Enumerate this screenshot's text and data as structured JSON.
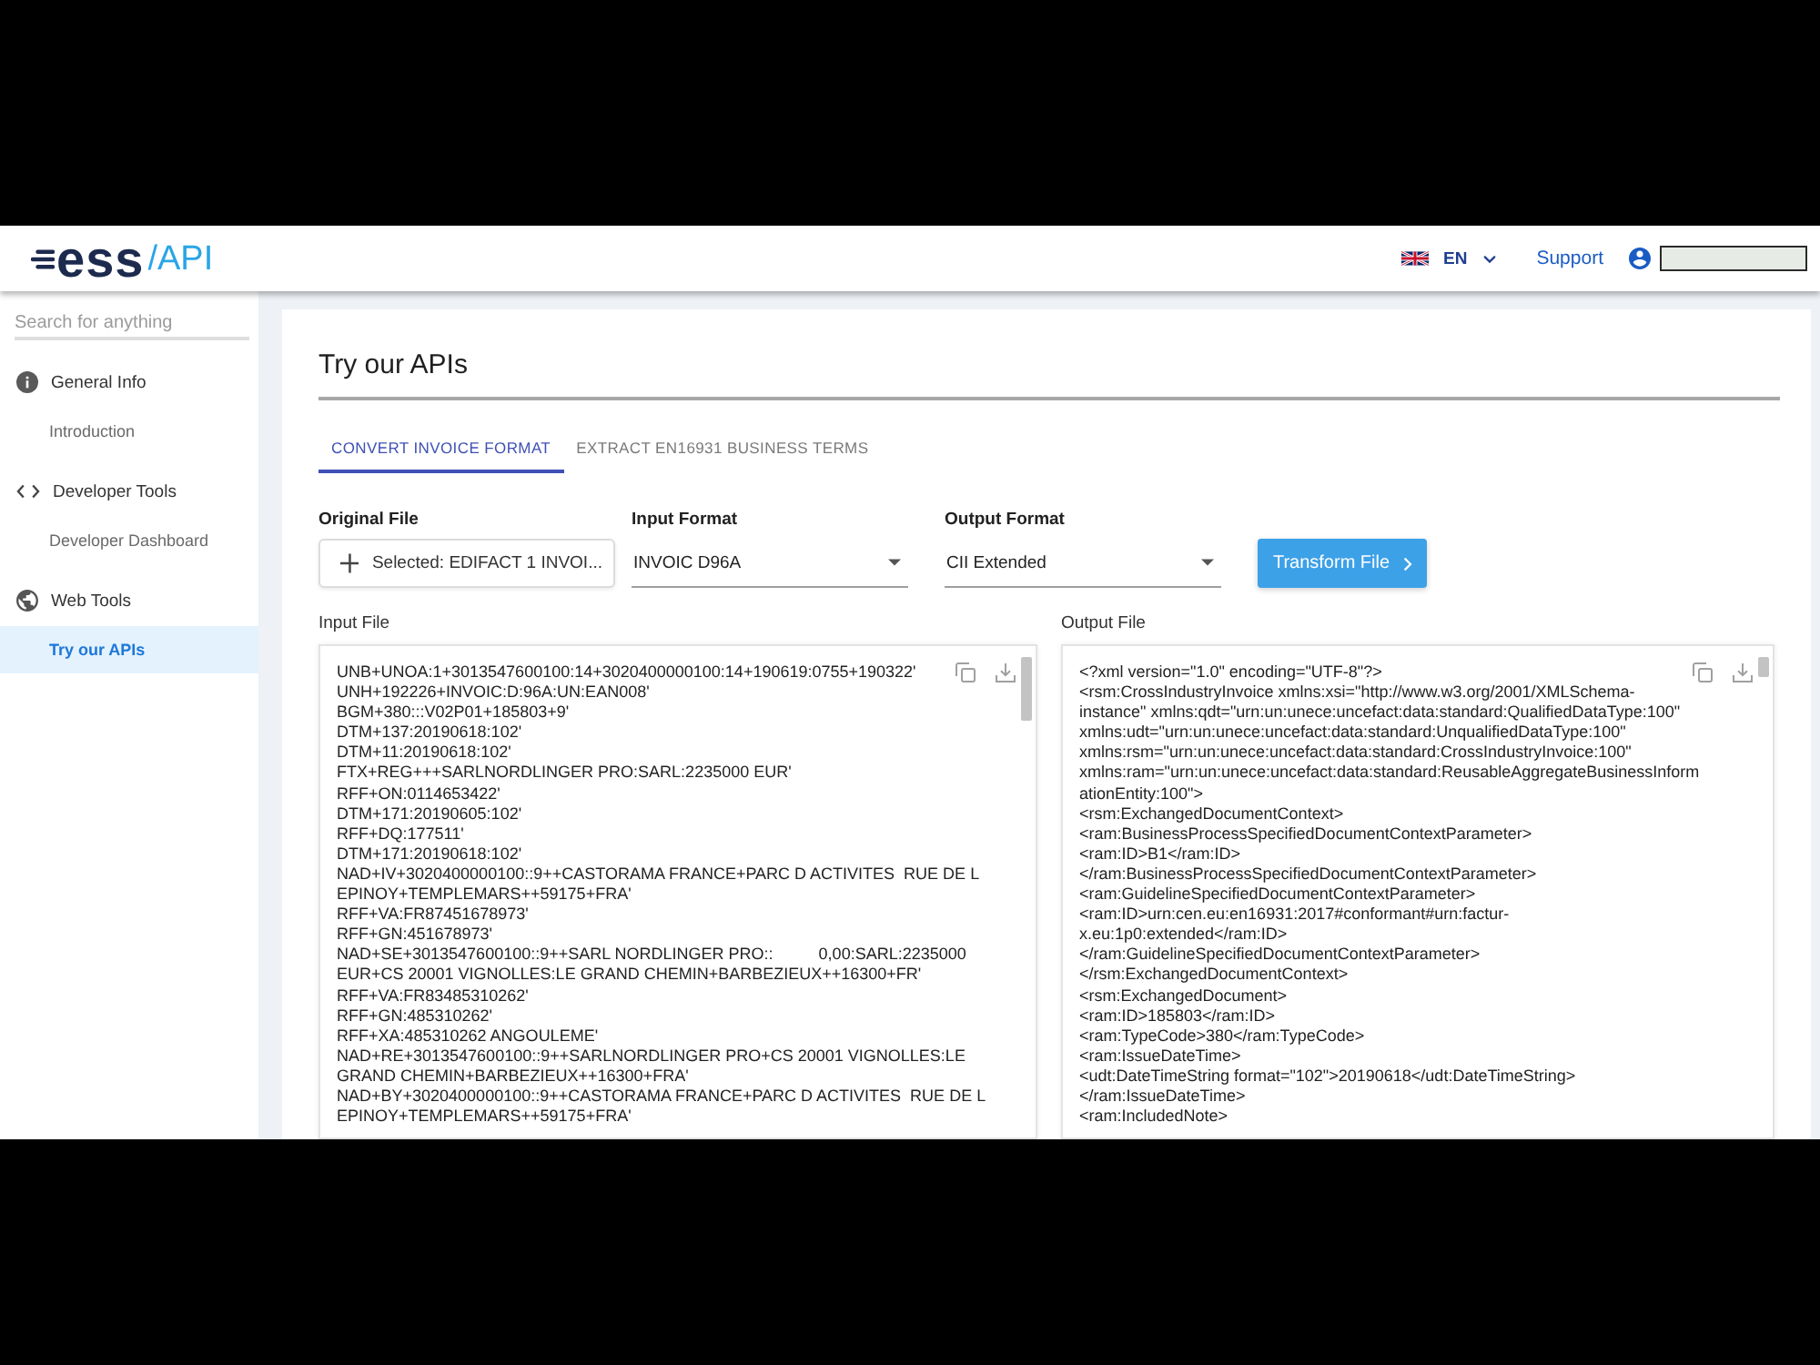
{
  "header": {
    "logo": {
      "wordmark": "ess",
      "suffix": "/API"
    },
    "language": "EN",
    "support_link": "Support"
  },
  "sidebar": {
    "search": {
      "placeholder": "Search for anything"
    },
    "sections": [
      {
        "label": "General Info",
        "children": [
          {
            "label": "Introduction",
            "selected": false
          }
        ]
      },
      {
        "label": "Developer Tools",
        "children": [
          {
            "label": "Developer Dashboard",
            "selected": false
          }
        ]
      },
      {
        "label": "Web Tools",
        "children": [
          {
            "label": "Try our APIs",
            "selected": true
          }
        ]
      }
    ]
  },
  "page": {
    "title": "Try our APIs",
    "tabs": [
      {
        "label": "CONVERT INVOICE FORMAT",
        "selected": true
      },
      {
        "label": "EXTRACT EN16931 BUSINESS TERMS",
        "selected": false
      }
    ],
    "form": {
      "fields": [
        {
          "kind": "file",
          "label": "Original File",
          "value": "Selected: EDIFACT 1 INVOI..."
        },
        {
          "kind": "select",
          "label": "Input Format",
          "value": "INVOIC D96A"
        },
        {
          "kind": "select",
          "label": "Output Format",
          "value": "CII Extended"
        }
      ],
      "submit_button": "Transform File"
    },
    "files": [
      {
        "label": "Input File",
        "lines": [
          "UNB+UNOA:1+3013547600100:14+3020400000100:14+190619:0755+190322'",
          "UNH+192226+INVOIC:D:96A:UN:EAN008'",
          "BGM+380:::V02P01+185803+9'",
          "DTM+137:20190618:102'",
          "DTM+11:20190618:102'",
          "FTX+REG+++SARLNORDLINGER PRO:SARL:2235000 EUR'",
          "RFF+ON:0114653422'",
          "DTM+171:20190605:102'",
          "RFF+DQ:177511'",
          "DTM+171:20190618:102'",
          "NAD+IV+3020400000100::9++CASTORAMA FRANCE+PARC D ACTIVITES  RUE DE L",
          "EPINOY+TEMPLEMARS++59175+FRA'",
          "RFF+VA:FR87451678973'",
          "RFF+GN:451678973'",
          "NAD+SE+3013547600100::9++SARL NORDLINGER PRO::          0,00:SARL:2235000",
          "EUR+CS 20001 VIGNOLLES:LE GRAND CHEMIN+BARBEZIEUX++16300+FR'",
          "RFF+VA:FR83485310262'",
          "RFF+GN:485310262'",
          "RFF+XA:485310262 ANGOULEME'",
          "NAD+RE+3013547600100::9++SARLNORDLINGER PRO+CS 20001 VIGNOLLES:LE",
          "GRAND CHEMIN+BARBEZIEUX++16300+FRA'",
          "NAD+BY+3020400000100::9++CASTORAMA FRANCE+PARC D ACTIVITES  RUE DE L",
          "EPINOY+TEMPLEMARS++59175+FRA'"
        ]
      },
      {
        "label": "Output File",
        "lines": [
          "<?xml version=\"1.0\" encoding=\"UTF-8\"?>",
          "<rsm:CrossIndustryInvoice xmlns:xsi=\"http://www.w3.org/2001/XMLSchema-",
          "instance\" xmlns:qdt=\"urn:un:unece:uncefact:data:standard:QualifiedDataType:100\"",
          "xmlns:udt=\"urn:un:unece:uncefact:data:standard:UnqualifiedDataType:100\"",
          "xmlns:rsm=\"urn:un:unece:uncefact:data:standard:CrossIndustryInvoice:100\"",
          "xmlns:ram=\"urn:un:unece:uncefact:data:standard:ReusableAggregateBusinessInform",
          "ationEntity:100\">",
          "<rsm:ExchangedDocumentContext>",
          "<ram:BusinessProcessSpecifiedDocumentContextParameter>",
          "<ram:ID>B1</ram:ID>",
          "</ram:BusinessProcessSpecifiedDocumentContextParameter>",
          "<ram:GuidelineSpecifiedDocumentContextParameter>",
          "<ram:ID>urn:cen.eu:en16931:2017#conformant#urn:factur-",
          "x.eu:1p0:extended</ram:ID>",
          "</ram:GuidelineSpecifiedDocumentContextParameter>",
          "</rsm:ExchangedDocumentContext>",
          "<rsm:ExchangedDocument>",
          "<ram:ID>185803</ram:ID>",
          "<ram:TypeCode>380</ram:TypeCode>",
          "<ram:IssueDateTime>",
          "<udt:DateTimeString format=\"102\">20190618</udt:DateTimeString>",
          "</ram:IssueDateTime>",
          "<ram:IncludedNote>"
        ]
      }
    ]
  }
}
